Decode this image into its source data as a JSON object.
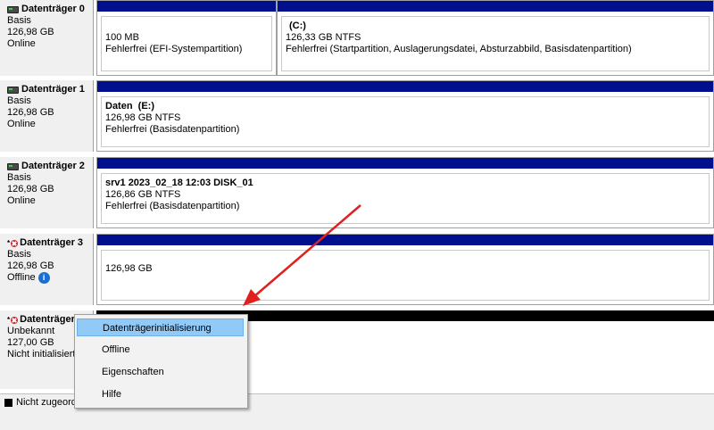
{
  "disks": [
    {
      "name": "Datenträger 0",
      "type": "Basis",
      "size": "126,98 GB",
      "status": "Online",
      "partitions": [
        {
          "title": "",
          "size": "100 MB",
          "status": "Fehlerfrei (EFI-Systempartition)"
        },
        {
          "title": "(C:)",
          "size": "126,33 GB NTFS",
          "status": "Fehlerfrei (Startpartition, Auslagerungsdatei, Absturzabbild, Basisdatenpartition)"
        }
      ]
    },
    {
      "name": "Datenträger 1",
      "type": "Basis",
      "size": "126,98 GB",
      "status": "Online",
      "partitions": [
        {
          "title": "Daten  (E:)",
          "size": "126,98 GB NTFS",
          "status": "Fehlerfrei (Basisdatenpartition)"
        }
      ]
    },
    {
      "name": "Datenträger 2",
      "type": "Basis",
      "size": "126,98 GB",
      "status": "Online",
      "partitions": [
        {
          "title": "srv1 2023_02_18 12:03 DISK_01",
          "size": "126,86 GB NTFS",
          "status": "Fehlerfrei (Basisdatenpartition)"
        }
      ]
    },
    {
      "name": "Datenträger 3",
      "type": "Basis",
      "size": "126,98 GB",
      "status": "Offline",
      "partitions": [
        {
          "title": "",
          "size": "126,98 GB",
          "status": ""
        }
      ]
    },
    {
      "name": "Datenträger",
      "type": "Unbekannt",
      "size": "127,00 GB",
      "status": "Nicht initialisiert",
      "partitions": []
    }
  ],
  "context_menu": {
    "items": [
      "Datenträgerinitialisierung",
      "Offline",
      "Eigenschaften",
      "Hilfe"
    ]
  },
  "legend": {
    "unallocated": "Nicht zugeord"
  },
  "colors": {
    "primary_partition_bar": "#000f8c",
    "unallocated_bar": "#000000",
    "menu_highlight": "#91c9f7",
    "arrow": "#e02020"
  },
  "icons": {
    "disk": "disk-icon",
    "disk_error": "disk-error-icon",
    "info": "info-icon"
  }
}
